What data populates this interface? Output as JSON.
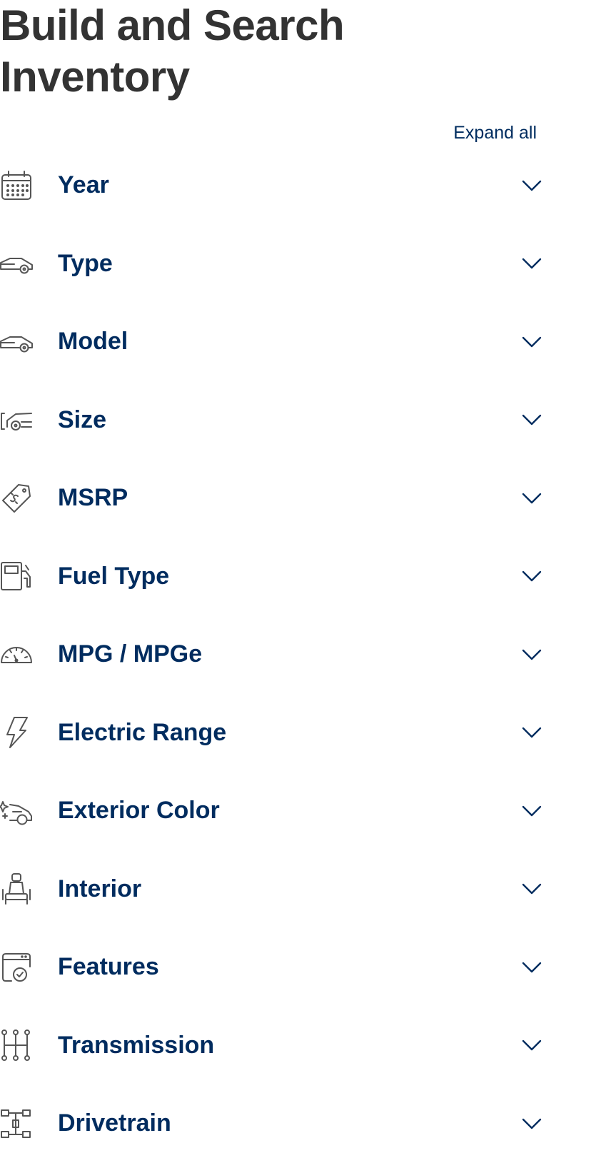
{
  "page": {
    "title": "Build and Search Inventory",
    "expand_all": "Expand all"
  },
  "filters": [
    {
      "label": "Year",
      "icon": "calendar-icon"
    },
    {
      "label": "Type",
      "icon": "car-icon"
    },
    {
      "label": "Model",
      "icon": "car-icon"
    },
    {
      "label": "Size",
      "icon": "car-size-icon"
    },
    {
      "label": "MSRP",
      "icon": "price-tag-icon"
    },
    {
      "label": "Fuel Type",
      "icon": "fuel-pump-icon"
    },
    {
      "label": "MPG / MPGe",
      "icon": "speedometer-icon"
    },
    {
      "label": "Electric Range",
      "icon": "lightning-bolt-icon"
    },
    {
      "label": "Exterior Color",
      "icon": "car-sparkle-icon"
    },
    {
      "label": "Interior",
      "icon": "car-seat-icon"
    },
    {
      "label": "Features",
      "icon": "feature-check-icon"
    },
    {
      "label": "Transmission",
      "icon": "gear-shift-icon"
    },
    {
      "label": "Drivetrain",
      "icon": "drivetrain-icon"
    }
  ],
  "colors": {
    "title": "#333333",
    "accent": "#002c5f",
    "icon": "#555555"
  }
}
